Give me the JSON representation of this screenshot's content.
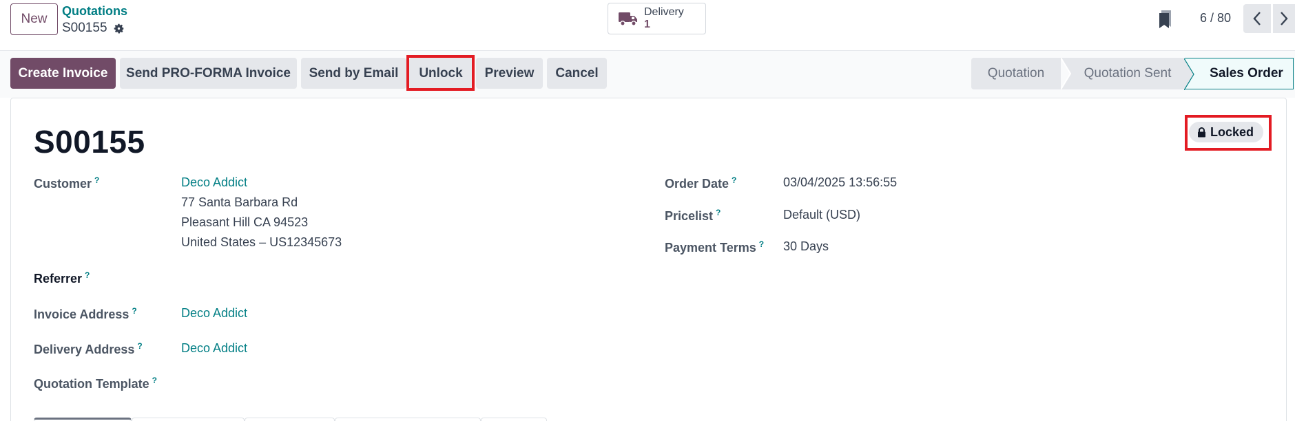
{
  "control_panel": {
    "new_label": "New",
    "breadcrumb_parent": "Quotations",
    "breadcrumb_current": "S00155",
    "smart_button": {
      "label": "Delivery",
      "count": "1",
      "icon": "truck-icon"
    },
    "pager": "6 / 80"
  },
  "actions": {
    "create_invoice": "Create Invoice",
    "send_proforma": "Send PRO-FORMA Invoice",
    "send_email": "Send by Email",
    "unlock": "Unlock",
    "preview": "Preview",
    "cancel": "Cancel"
  },
  "stages": [
    "Quotation",
    "Quotation Sent",
    "Sales Order"
  ],
  "active_stage": "Sales Order",
  "form": {
    "title": "S00155",
    "locked_badge": "Locked",
    "customer": {
      "label": "Customer",
      "name": "Deco Addict",
      "address_line1": "77 Santa Barbara Rd",
      "address_line2": "Pleasant Hill CA 94523",
      "address_line3": "United States – US12345673"
    },
    "referrer_label": "Referrer",
    "invoice_address": {
      "label": "Invoice Address",
      "value": "Deco Addict"
    },
    "delivery_address": {
      "label": "Delivery Address",
      "value": "Deco Addict"
    },
    "quotation_template_label": "Quotation Template",
    "order_date": {
      "label": "Order Date",
      "value": "03/04/2025 13:56:55"
    },
    "pricelist": {
      "label": "Pricelist",
      "value": "Default (USD)"
    },
    "payment_terms": {
      "label": "Payment Terms",
      "value": "30 Days"
    },
    "help_marker": "?"
  },
  "colors": {
    "brand": "#714b67",
    "link": "#017e84",
    "highlight": "#e31b23"
  }
}
